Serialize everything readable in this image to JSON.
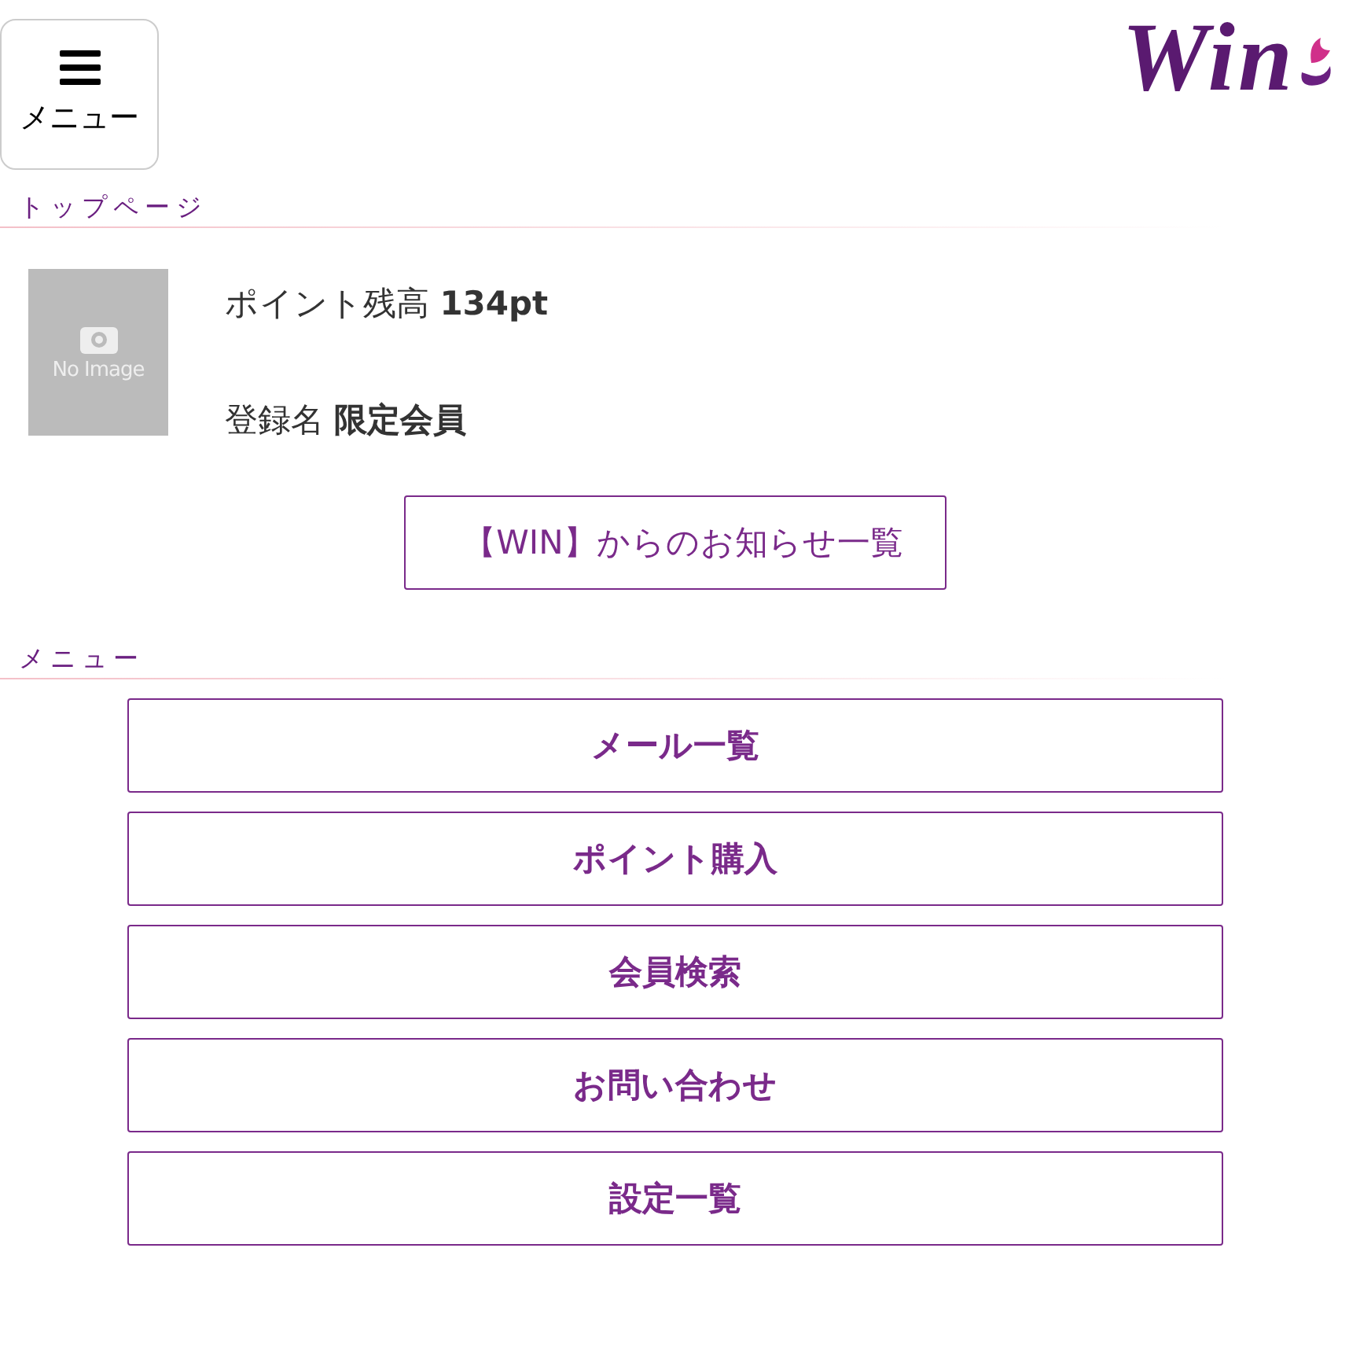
{
  "header": {
    "menu_button": {
      "label": "メニュー"
    },
    "logo": "Win"
  },
  "top_section": {
    "title": "トップページ"
  },
  "profile": {
    "photo": {
      "placeholder": "No Image"
    },
    "points": {
      "label": "ポイント残高",
      "value": "134pt"
    },
    "name": {
      "label": "登録名",
      "value": "限定会員"
    }
  },
  "notice_button": "【WIN】からのお知らせ一覧",
  "menu_section": {
    "title": "メニュー",
    "items": [
      {
        "label": "メール一覧"
      },
      {
        "label": "ポイント購入"
      },
      {
        "label": "会員検索"
      },
      {
        "label": "お問い合わせ"
      },
      {
        "label": "設定一覧"
      }
    ]
  }
}
